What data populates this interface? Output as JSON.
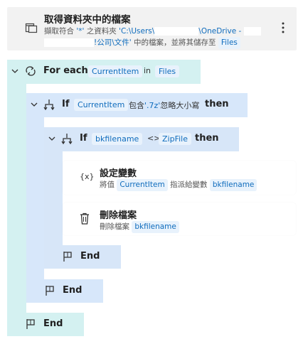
{
  "get_files": {
    "title": "取得資料夾中的檔案",
    "line1_prefix": "擷取符合 ",
    "filter": "'*'",
    "line1_mid": " 之資料夾 ",
    "path_part1": "'C:\\Users\\",
    "path_part2": "\\OneDrive - ",
    "path_part3": "!公司\\文件'",
    "line2_suffix": " 中的檔案，並將其儲存至 ",
    "output_var": "Files"
  },
  "for_each": {
    "keyword": "For each",
    "item_var": "CurrentItem",
    "in_label": "in",
    "collection_var": "Files",
    "end_label": "End"
  },
  "if_outer": {
    "keyword": "If",
    "var": "CurrentItem",
    "op": "包含",
    "value": "'.7z'",
    "option": "忽略大小寫",
    "then_label": "then",
    "end_label": "End"
  },
  "if_inner": {
    "keyword": "If",
    "var": "bkfilename",
    "op": "<>",
    "value": "ZipFile",
    "then_label": "then",
    "end_label": "End"
  },
  "set_variable": {
    "title": "設定變數",
    "icon_text": "{x}",
    "prefix": "將值",
    "value_var": "CurrentItem",
    "mid": "指派給變數",
    "target_var": "bkfilename"
  },
  "delete_file": {
    "title": "刪除檔案",
    "prefix": "刪除檔案",
    "file_var": "bkfilename"
  }
}
